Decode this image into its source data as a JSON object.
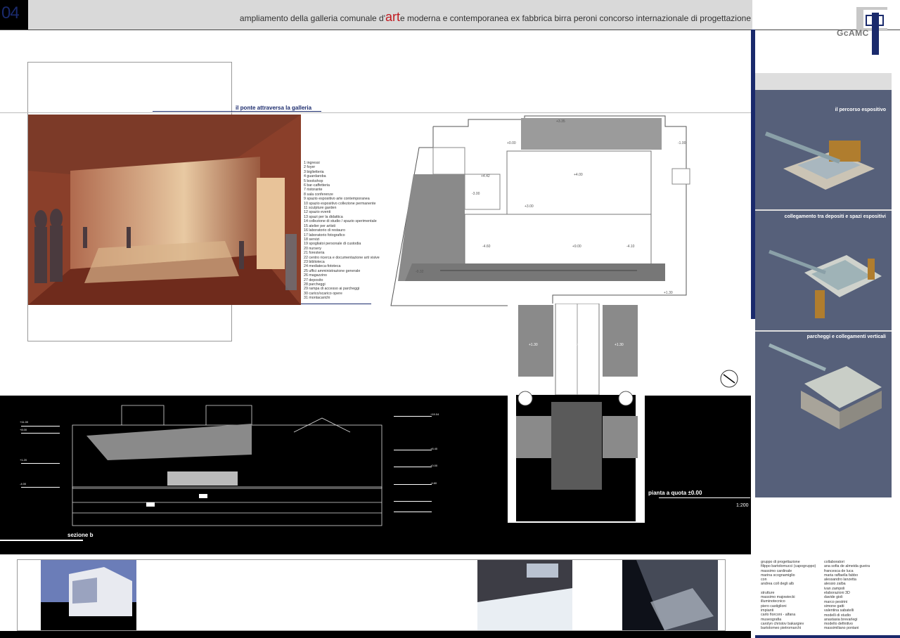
{
  "header": {
    "sheet_number": "04",
    "title_before": "ampliamento della galleria comunale d'",
    "title_art": "art",
    "title_after": "e moderna e contemporanea ex fabbrica birra peroni  concorso internazionale di progettazione",
    "logo_text": "GcAMC"
  },
  "bridge_caption": "il ponte attraversa la galleria",
  "legend": [
    "1 ingressi",
    "2 foyer",
    "3 biglietteria",
    "4 guardaroba",
    "5 bookshop",
    "6 bar-caffetteria",
    "7 ristorante",
    "8 sala conferenze",
    "9 spazio espositivo arte contemporanea",
    "10 spazio espositivo collezione permanente",
    "11 sculpture garden",
    "12 spazio eventi",
    "13 spazi per la didattica",
    "14 collezione di studio / spazio sperimentale",
    "15 atelier per artisti",
    "16 laboratorio di restauro",
    "17 laboratorio fotografico",
    "18 servizi",
    "19 spogliatoi personale di custodia",
    "20 nursery",
    "21 foresteria",
    "22 centro ricerca e documentazione arti visive",
    "23 biblioteca",
    "24 mediateca-fototeca",
    "25 uffici amministrazione generale",
    "26 magazzino",
    "27 deposito",
    "28 parcheggi",
    "29 rampa di accesso ai parcheggi",
    "30 carico/scarico opere",
    "31 montacarichi"
  ],
  "plan_labels": {
    "title": "pianta a quota ±0.00",
    "scale": "1:200",
    "levels": [
      "+3.35",
      "+0.00",
      "-1.00",
      "+4.42",
      "-3.00",
      "+3.00",
      "+4.00",
      "-4.60",
      "+9.00",
      "-4.10",
      "-0.32",
      "+1.30",
      "+1.30",
      "+0.00",
      "+1.30"
    ]
  },
  "section_label": "sezione b",
  "section_levels_left": [
    "+11.00",
    "+8.00",
    "+1.20",
    "-4.00"
  ],
  "section_levels_right": [
    "+19.04",
    "+8.40",
    "+0.00",
    "-4.60"
  ],
  "panels": [
    {
      "title": "il percorso espositivo"
    },
    {
      "title": "collegamento tra depositi e spazi espositivi"
    },
    {
      "title": "parcheggi e collegamenti verticali"
    }
  ],
  "credits_col1": [
    "gruppo di progettazione",
    "filippo bartolomucci (capogruppo)",
    "massimo cardinale",
    "marina scognamiglio",
    "con",
    "andrea coll degli alb",
    "",
    "strutture",
    "massimo majowiecki",
    "illuminotecnico",
    "piero castiglioni",
    "impianti",
    "carlo fiorconi - alfana",
    "museografia",
    "carolyn christov bakargiev",
    "bartolomeo pietromarchi"
  ],
  "credits_col2": [
    "collaboratori",
    "ana sofia de almeida gueira",
    "francesca de luca",
    "maria raffaella fabbo",
    "alessandro lanzetta",
    "alessio zalba",
    "ivan zampoli",
    "elaborazioni 3D",
    "davide gioli",
    "marco pestrini",
    "simone gatti",
    "valentina sabatelli",
    "modelli di studio",
    "anastasia brevarlegi",
    "modello definitivo",
    "massimiliano pontani"
  ],
  "colors": {
    "navy": "#1a2a6c",
    "accent_red": "#c0191f",
    "panel_blue": "#56607a",
    "header_grey": "#d9d9d9"
  }
}
